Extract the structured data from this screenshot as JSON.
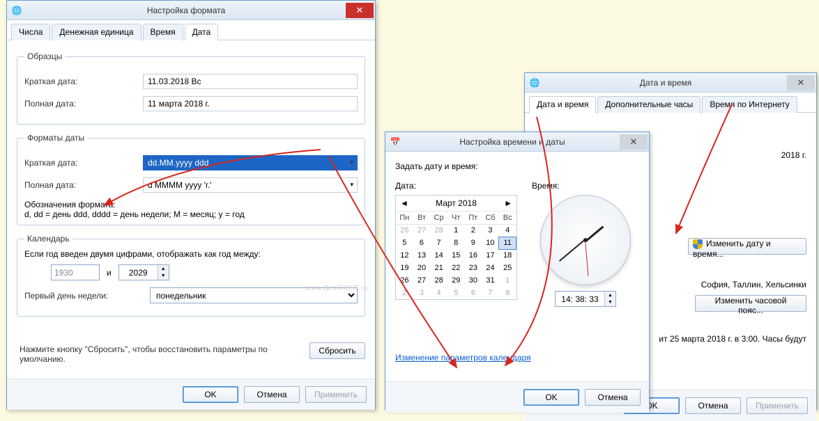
{
  "w1": {
    "title": "Настройка формата",
    "tabs": [
      "Числа",
      "Денежная единица",
      "Время",
      "Дата"
    ],
    "samples": {
      "legend": "Образцы",
      "short_lbl": "Краткая дата:",
      "short_val": "11.03.2018 Вс",
      "long_lbl": "Полная дата:",
      "long_val": "11 марта 2018 г."
    },
    "formats": {
      "legend": "Форматы даты",
      "short_lbl": "Краткая дата:",
      "short_val": "dd.MM.yyyy ddd",
      "long_lbl": "Полная дата:",
      "long_val": "d MMMM yyyy 'г.'",
      "legend_lbl": "Обозначения формата:",
      "legend_txt": "d, dd = день   ddd, dddd = день недели;  M = месяц;  y = год"
    },
    "calendar": {
      "legend": "Календарь",
      "twodigit": "Если год введен двумя цифрами, отображать как год между:",
      "from": "1930",
      "and": "и",
      "to": "2029",
      "firstday_lbl": "Первый день недели:",
      "firstday": "понедельник"
    },
    "reset_note": "Нажмите кнопку \"Сбросить\", чтобы восстановить параметры по умолчанию.",
    "reset": "Сбросить",
    "ok": "OK",
    "cancel": "Отмена",
    "apply": "Применить"
  },
  "w2": {
    "title": "Настройка времени и даты",
    "prompt": "Задать дату и время:",
    "date_lbl": "Дата:",
    "time_lbl": "Время:",
    "month": "Март 2018",
    "dow": [
      "Пн",
      "Вт",
      "Ср",
      "Чт",
      "Пт",
      "Сб",
      "Вс"
    ],
    "grid": [
      [
        "26",
        "27",
        "28",
        "1",
        "2",
        "3",
        "4"
      ],
      [
        "5",
        "6",
        "7",
        "8",
        "9",
        "10",
        "11"
      ],
      [
        "12",
        "13",
        "14",
        "15",
        "16",
        "17",
        "18"
      ],
      [
        "19",
        "20",
        "21",
        "22",
        "23",
        "24",
        "25"
      ],
      [
        "26",
        "27",
        "28",
        "29",
        "30",
        "31",
        "1"
      ],
      [
        "2",
        "3",
        "4",
        "5",
        "6",
        "7",
        "8"
      ]
    ],
    "today_row": 1,
    "today_col": 6,
    "time_val": "14: 38: 33",
    "link": "Изменение параметров календаря",
    "ok": "OK",
    "cancel": "Отмена"
  },
  "w3": {
    "title": "Дата и время",
    "tabs": [
      "Дата и время",
      "Дополнительные часы",
      "Время по Интернету"
    ],
    "year_frag": "2018 г.",
    "change_dt": "Изменить дату и время...",
    "tz_frag": "София, Таллин, Хельсинки",
    "change_tz": "Изменить часовой пояс...",
    "dst_frag": "ит 25 марта 2018 г. в 3:00. Часы будут",
    "ok": "OK",
    "cancel": "Отмена",
    "apply": "Применить"
  },
  "watermark": "www.BestFREE.ru"
}
